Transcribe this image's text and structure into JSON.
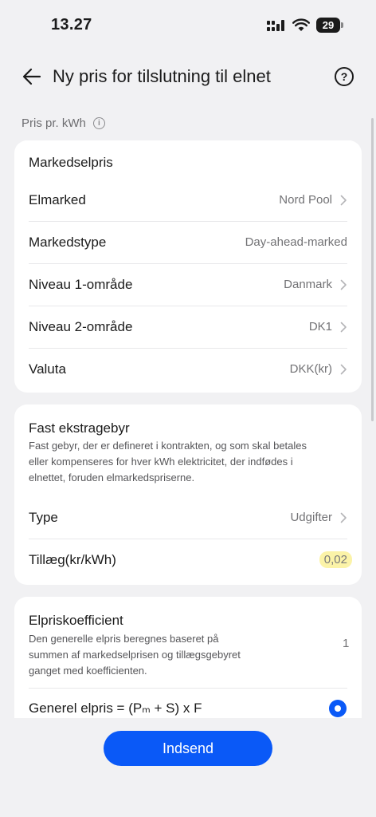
{
  "status": {
    "time": "13.27",
    "battery": "29"
  },
  "header": {
    "title": "Ny pris for tilslutning til elnet",
    "help": "?"
  },
  "section_label": "Pris pr. kWh",
  "market": {
    "title": "Markedselpris",
    "rows": [
      {
        "label": "Elmarked",
        "value": "Nord Pool",
        "chevron": true
      },
      {
        "label": "Markedstype",
        "value": "Day-ahead-marked",
        "chevron": false
      },
      {
        "label": "Niveau 1-område",
        "value": "Danmark",
        "chevron": true
      },
      {
        "label": "Niveau 2-område",
        "value": "DK1",
        "chevron": true
      },
      {
        "label": "Valuta",
        "value": "DKK(kr)",
        "chevron": true
      }
    ]
  },
  "fixed": {
    "title": "Fast ekstragebyr",
    "description_lines": [
      "Fast gebyr, der er defineret i kontrakten, og som skal betales",
      "eller kompenseres for hver kWh elektricitet, der indfødes i",
      "elnettet, foruden elmarkedspriserne."
    ],
    "type_label": "Type",
    "type_value": "Udgifter",
    "surcharge_label": "Tillæg(kr/kWh)",
    "surcharge_value": "0,02"
  },
  "coef": {
    "title": "Elpriskoefficient",
    "description_lines": [
      "Den generelle elpris beregnes baseret på",
      "summen af markedselprisen og tillægsgebyret",
      "ganget med koefficienten."
    ],
    "value": "1",
    "formula": "Generel elpris = (Pₘ + S) x F"
  },
  "submit_label": "Indsend"
}
